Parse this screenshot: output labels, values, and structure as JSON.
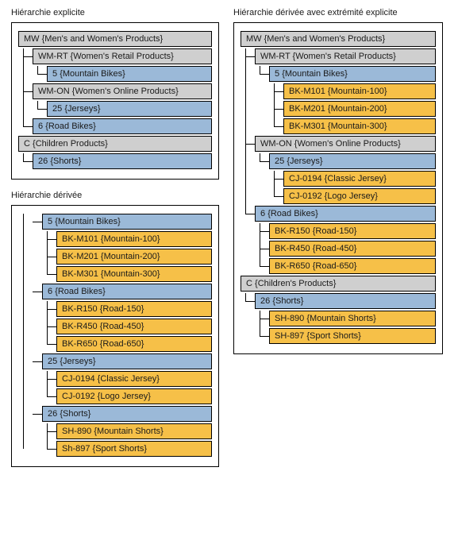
{
  "titles": {
    "explicit": "Hiérarchie explicite",
    "derived": "Hiérarchie dérivée",
    "derived_explicit_cap": "Hiérarchie dérivée avec extrémité explicite"
  },
  "explicit": {
    "n0": {
      "code": "MW",
      "name": "{Men's and Women's Products}"
    },
    "n1": {
      "code": "WM-RT",
      "name": "{Women's Retail Products}"
    },
    "n2": {
      "code": "5",
      "name": "{Mountain Bikes}"
    },
    "n3": {
      "code": "WM-ON",
      "name": "{Women's Online Products}"
    },
    "n4": {
      "code": "25",
      "name": "{Jerseys}"
    },
    "n5": {
      "code": "6",
      "name": "{Road Bikes}"
    },
    "n6": {
      "code": "C",
      "name": "{Children Products}"
    },
    "n7": {
      "code": "26",
      "name": "{Shorts}"
    }
  },
  "derived": {
    "g0": {
      "code": "5",
      "name": "{Mountain Bikes}"
    },
    "g0a": {
      "code": "BK-M101",
      "name": "{Mountain-100}"
    },
    "g0b": {
      "code": "BK-M201",
      "name": "{Mountain-200}"
    },
    "g0c": {
      "code": "BK-M301",
      "name": "{Mountain-300}"
    },
    "g1": {
      "code": "6",
      "name": "{Road Bikes}"
    },
    "g1a": {
      "code": "BK-R150",
      "name": "{Road-150}"
    },
    "g1b": {
      "code": "BK-R450",
      "name": "{Road-450}"
    },
    "g1c": {
      "code": "BK-R650",
      "name": "{Road-650}"
    },
    "g2": {
      "code": "25",
      "name": "{Jerseys}"
    },
    "g2a": {
      "code": "CJ-0194",
      "name": "{Classic Jersey}"
    },
    "g2b": {
      "code": "CJ-0192",
      "name": "{Logo Jersey}"
    },
    "g3": {
      "code": "26",
      "name": "{Shorts}"
    },
    "g3a": {
      "code": "SH-890",
      "name": "{Mountain Shorts}"
    },
    "g3b": {
      "code": "Sh-897",
      "name": "{Sport Shorts}"
    }
  },
  "capped": {
    "n0": {
      "code": "MW",
      "name": "{Men's and Women's Products}"
    },
    "n1": {
      "code": "WM-RT",
      "name": "{Women's Retail Products}"
    },
    "n2": {
      "code": "5",
      "name": "{Mountain Bikes}"
    },
    "n2a": {
      "code": "BK-M101",
      "name": "{Mountain-100}"
    },
    "n2b": {
      "code": "BK-M201",
      "name": "{Mountain-200}"
    },
    "n2c": {
      "code": "BK-M301",
      "name": "{Mountain-300}"
    },
    "n3": {
      "code": "WM-ON",
      "name": "{Women's Online Products}"
    },
    "n4": {
      "code": "25",
      "name": "{Jerseys}"
    },
    "n4a": {
      "code": "CJ-0194",
      "name": "{Classic Jersey}"
    },
    "n4b": {
      "code": "CJ-0192",
      "name": "{Logo Jersey}"
    },
    "n5": {
      "code": "6",
      "name": "{Road Bikes}"
    },
    "n5a": {
      "code": "BK-R150",
      "name": "{Road-150}"
    },
    "n5b": {
      "code": "BK-R450",
      "name": "{Road-450}"
    },
    "n5c": {
      "code": "BK-R650",
      "name": "{Road-650}"
    },
    "n6": {
      "code": "C",
      "name": "{Children's Products}"
    },
    "n7": {
      "code": "26",
      "name": "{Shorts}"
    },
    "n7a": {
      "code": "SH-890",
      "name": "{Mountain Shorts}"
    },
    "n7b": {
      "code": "SH-897",
      "name": "{Sport Shorts}"
    }
  }
}
